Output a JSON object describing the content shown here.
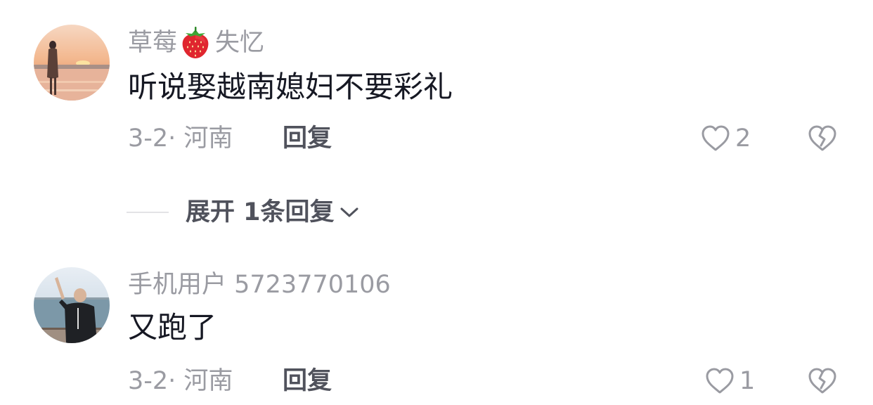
{
  "comments": [
    {
      "username_part1": "草莓",
      "username_emoji": "strawberry-emoji",
      "username_part2": "失忆",
      "text": "听说娶越南媳妇不要彩礼",
      "meta": "3-2· 河南",
      "reply_label": "回复",
      "like_count": "2"
    },
    {
      "username": "手机用户 5723770106",
      "text": "又跑了",
      "meta": "3-2· 河南",
      "reply_label": "回复",
      "like_count": "1"
    }
  ],
  "expand_replies": {
    "label": "展开 1条回复"
  },
  "icons": {
    "like": "heart-outline-icon",
    "dislike": "broken-heart-icon",
    "expand": "chevron-down-icon"
  },
  "colors": {
    "text_primary": "#161823",
    "text_secondary": "#9a9ba2",
    "reply_text": "#50525c",
    "divider": "#e3e3e6"
  }
}
